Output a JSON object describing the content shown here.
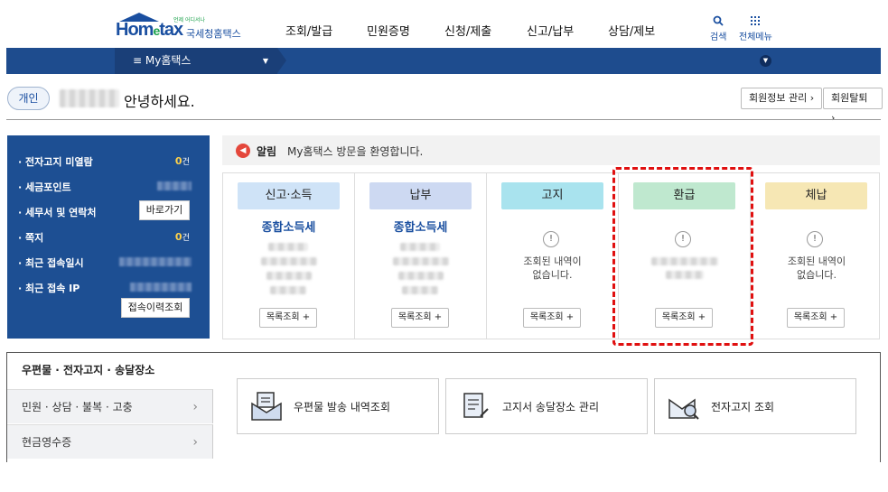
{
  "header": {
    "logo_brand": "Hometax",
    "logo_brand_e": "e",
    "logo_tiny": "언제 어디서나",
    "logo_sub": "국세청홈택스",
    "menu": [
      "조회/발급",
      "민원증명",
      "신청/제출",
      "신고/납부",
      "상담/제보"
    ],
    "search_label": "검색",
    "allmenu_label": "전체메뉴"
  },
  "navbar": {
    "my_label": "≡  My홈택스"
  },
  "greeting": {
    "badge": "개인",
    "text": "안녕하세요.",
    "member_info": "회원정보 관리 ›",
    "withdraw": "회원탈퇴 ›"
  },
  "info_panel": {
    "unread_label": "전자고지 미열람",
    "unread_value": "0",
    "unread_unit": "건",
    "points_label": "세금포인트",
    "tax_agent_label": "세무서 및 연락처",
    "shortcut_btn": "바로가기",
    "memo_label": "쪽지",
    "memo_value": "0",
    "memo_unit": "건",
    "last_login_label": "최근 접속일시",
    "last_ip_label": "최근 접속 IP",
    "history_btn": "접속이력조회"
  },
  "notice": {
    "label": "알림",
    "message": "My홈택스 방문을 환영합니다."
  },
  "cards": [
    {
      "title": "신고·소득",
      "tax": "종합소득세",
      "color": "#cfe3f7",
      "button": "목록조회 +",
      "empty": ""
    },
    {
      "title": "납부",
      "tax": "종합소득세",
      "color": "#cdd9f2",
      "button": "목록조회 +",
      "empty": ""
    },
    {
      "title": "고지",
      "tax": "",
      "color": "#a9e3ee",
      "button": "목록조회 +",
      "empty": "조회된 내역이\n없습니다."
    },
    {
      "title": "환급",
      "tax": "",
      "color": "#bfe8cf",
      "button": "목록조회 +",
      "empty": ""
    },
    {
      "title": "체납",
      "tax": "",
      "color": "#f6e7b4",
      "button": "목록조회 +",
      "empty": "조회된 내역이\n없습니다."
    }
  ],
  "bottom": {
    "tab_title": "우편물 · 전자고지 · 송달장소",
    "side_menu": [
      "민원 · 상담 · 불복 · 고충",
      "현금영수증"
    ],
    "services": [
      "우편물 발송 내역조회",
      "고지서 송달장소 관리",
      "전자고지 조회"
    ]
  }
}
